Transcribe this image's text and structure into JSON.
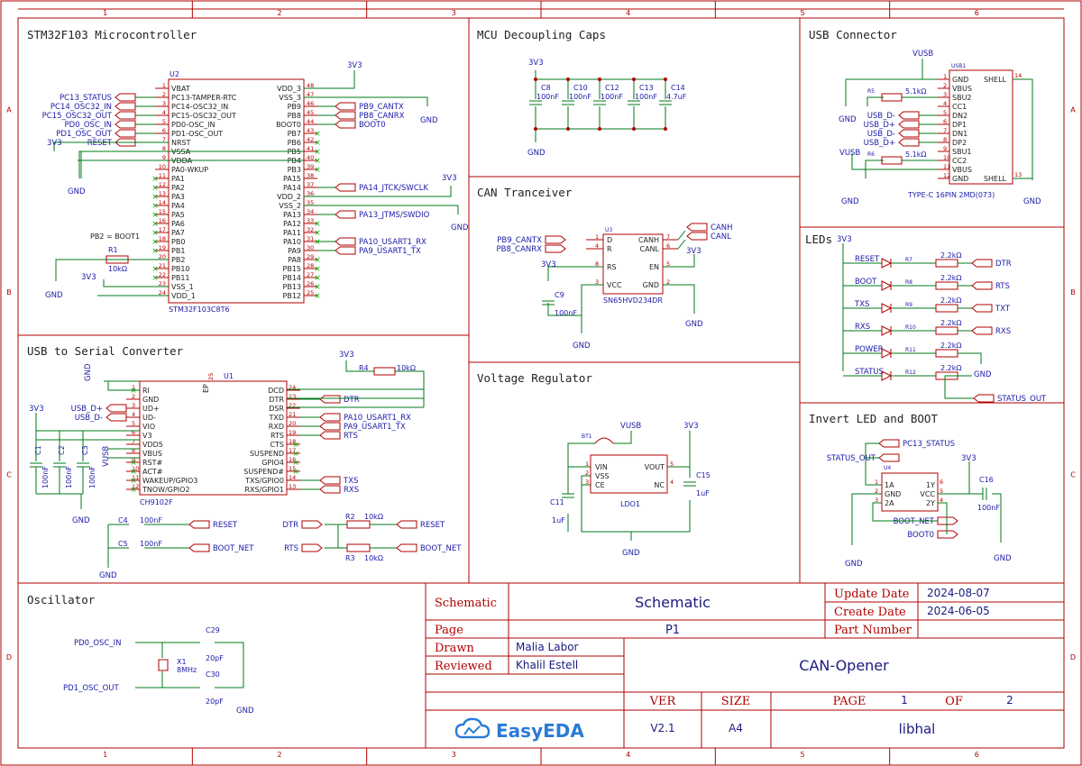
{
  "ruler": {
    "cols": [
      "1",
      "2",
      "3",
      "4",
      "5",
      "6"
    ],
    "rows": [
      "A",
      "B",
      "C",
      "D"
    ]
  },
  "sections": {
    "mcu": "STM32F103 Microcontroller",
    "decoupling": "MCU Decoupling Caps",
    "usb": "USB Connector",
    "can": "CAN Tranceiver",
    "leds": "LEDs",
    "usbserial": "USB to Serial Converter",
    "regulator": "Voltage Regulator",
    "invert": "Invert LED and BOOT",
    "osc": "Oscillator"
  },
  "mcu": {
    "ref": "U2",
    "part": "STM32F103C8T6",
    "left_pins": [
      {
        "n": "1",
        "name": "VBAT"
      },
      {
        "n": "2",
        "name": "PC13-TAMPER-RTC"
      },
      {
        "n": "3",
        "name": "PC14-OSC32_IN"
      },
      {
        "n": "4",
        "name": "PC15-OSC32_OUT"
      },
      {
        "n": "5",
        "name": "PD0-OSC_IN"
      },
      {
        "n": "6",
        "name": "PD1-OSC_OUT"
      },
      {
        "n": "7",
        "name": "NRST"
      },
      {
        "n": "8",
        "name": "VSSA"
      },
      {
        "n": "9",
        "name": "VDDA"
      },
      {
        "n": "10",
        "name": "PA0-WKUP"
      },
      {
        "n": "11",
        "name": "PA1"
      },
      {
        "n": "12",
        "name": "PA2"
      },
      {
        "n": "13",
        "name": "PA3"
      },
      {
        "n": "14",
        "name": "PA4"
      },
      {
        "n": "15",
        "name": "PA5"
      },
      {
        "n": "16",
        "name": "PA6"
      },
      {
        "n": "17",
        "name": "PA7"
      },
      {
        "n": "18",
        "name": "PB0"
      },
      {
        "n": "19",
        "name": "PB1"
      },
      {
        "n": "20",
        "name": "PB2"
      },
      {
        "n": "21",
        "name": "PB10"
      },
      {
        "n": "22",
        "name": "PB11"
      },
      {
        "n": "23",
        "name": "VSS_1"
      },
      {
        "n": "24",
        "name": "VDD_1"
      }
    ],
    "right_pins": [
      {
        "n": "48",
        "name": "VDD_3"
      },
      {
        "n": "47",
        "name": "VSS_3"
      },
      {
        "n": "46",
        "name": "PB9"
      },
      {
        "n": "45",
        "name": "PB8"
      },
      {
        "n": "44",
        "name": "BOOT0"
      },
      {
        "n": "43",
        "name": "PB7"
      },
      {
        "n": "42",
        "name": "PB6"
      },
      {
        "n": "41",
        "name": "PB5"
      },
      {
        "n": "40",
        "name": "PB4"
      },
      {
        "n": "39",
        "name": "PB3"
      },
      {
        "n": "38",
        "name": "PA15"
      },
      {
        "n": "37",
        "name": "PA14"
      },
      {
        "n": "36",
        "name": "VDD_2"
      },
      {
        "n": "35",
        "name": "VSS_2"
      },
      {
        "n": "34",
        "name": "PA13"
      },
      {
        "n": "33",
        "name": "PA12"
      },
      {
        "n": "32",
        "name": "PA11"
      },
      {
        "n": "31",
        "name": "PA10"
      },
      {
        "n": "30",
        "name": "PA9"
      },
      {
        "n": "29",
        "name": "PA8"
      },
      {
        "n": "28",
        "name": "PB15"
      },
      {
        "n": "27",
        "name": "PB14"
      },
      {
        "n": "26",
        "name": "PB13"
      },
      {
        "n": "25",
        "name": "PB12"
      }
    ],
    "left_nets": [
      "PC13_STATUS",
      "PC14_OSC32_IN",
      "PC15_OSC32_OUT",
      "PD0_OSC_IN",
      "PD1_OSC_OUT",
      "RESET"
    ],
    "right_nets": [
      "PB9_CANTX",
      "PB8_CANRX",
      "BOOT0",
      "PA14_JTCK/SWCLK",
      "PA13_JTMS/SWDIO",
      "PA10_USART1_RX",
      "PA9_USART1_TX"
    ],
    "pb2_note": "PB2 = BOOT1",
    "r1_ref": "R1",
    "r1_val": "10kΩ"
  },
  "decoupling": {
    "caps": [
      {
        "ref": "C8",
        "val": "100nF"
      },
      {
        "ref": "C10",
        "val": "100nF"
      },
      {
        "ref": "C12",
        "val": "100nF"
      },
      {
        "ref": "C13",
        "val": "100nF"
      },
      {
        "ref": "C14",
        "val": "4.7uF"
      }
    ]
  },
  "usb": {
    "ref": "USB1",
    "part": "TYPE-C 16PIN 2MD(073)",
    "left_pins": [
      "GND",
      "VBUS",
      "SBU2",
      "CC1",
      "DN2",
      "DP1",
      "DN1",
      "DP2",
      "SBU1",
      "CC2",
      "VBUS",
      "GND"
    ],
    "right_pins": [
      "SHELL",
      "SHELL"
    ],
    "right_nums": [
      "14",
      "13"
    ],
    "nets": [
      "USB_D-",
      "USB_D+",
      "USB_D-",
      "USB_D+"
    ],
    "r5": {
      "ref": "R5",
      "val": "5.1kΩ"
    },
    "r6": {
      "ref": "R6",
      "val": "5.1kΩ"
    }
  },
  "can": {
    "ref": "U3",
    "part": "SN65HVD234DR",
    "left_pins": [
      {
        "n": "1",
        "name": "D"
      },
      {
        "n": "4",
        "name": "R"
      },
      {
        "n": "8",
        "name": "RS"
      },
      {
        "n": "3",
        "name": "VCC"
      }
    ],
    "right_pins": [
      {
        "n": "7",
        "name": "CANH"
      },
      {
        "n": "6",
        "name": "CANL"
      },
      {
        "n": "5",
        "name": "EN"
      },
      {
        "n": "2",
        "name": "GND"
      }
    ],
    "in_nets": [
      "PB9_CANTX",
      "PB8_CANRX"
    ],
    "out_nets": [
      "CANH",
      "CANL"
    ],
    "c9": {
      "ref": "C9",
      "val": "100nF"
    }
  },
  "leds": {
    "items": [
      {
        "net": "RESET",
        "r": "R7",
        "val": "2.2kΩ",
        "out": "DTR"
      },
      {
        "net": "BOOT",
        "r": "R8",
        "val": "2.2kΩ",
        "out": "RTS"
      },
      {
        "net": "TXS",
        "r": "R9",
        "val": "2.2kΩ",
        "out": "TXT"
      },
      {
        "net": "RXS",
        "r": "R10",
        "val": "2.2kΩ",
        "out": "RXS"
      },
      {
        "net": "POWER",
        "r": "R11",
        "val": "2.2kΩ",
        "out": ""
      },
      {
        "net": "STATUS",
        "r": "R12",
        "val": "2.2kΩ",
        "out": "STATUS_OUT"
      }
    ]
  },
  "usbserial": {
    "ref": "U1",
    "part": "CH9102F",
    "left_pins": [
      {
        "n": "1",
        "name": "RI"
      },
      {
        "n": "2",
        "name": "GND"
      },
      {
        "n": "3",
        "name": "UD+"
      },
      {
        "n": "4",
        "name": "UD-"
      },
      {
        "n": "5",
        "name": "VIO"
      },
      {
        "n": "6",
        "name": "V3"
      },
      {
        "n": "7",
        "name": "VDD5"
      },
      {
        "n": "8",
        "name": "VBUS"
      },
      {
        "n": "9",
        "name": "RST#"
      },
      {
        "n": "10",
        "name": "ACT#"
      },
      {
        "n": "11",
        "name": "WAKEUP/GPIO3"
      },
      {
        "n": "12",
        "name": "TNOW/GPIO2"
      }
    ],
    "right_pins": [
      {
        "n": "24",
        "name": "DCD"
      },
      {
        "n": "23",
        "name": "DTR"
      },
      {
        "n": "22",
        "name": "DSR"
      },
      {
        "n": "21",
        "name": "TXD"
      },
      {
        "n": "20",
        "name": "RXD"
      },
      {
        "n": "19",
        "name": "RTS"
      },
      {
        "n": "18",
        "name": "CTS"
      },
      {
        "n": "17",
        "name": "SUSPEND"
      },
      {
        "n": "16",
        "name": "GPIO4"
      },
      {
        "n": "15",
        "name": "SUSPEND#"
      },
      {
        "n": "14",
        "name": "TXS/GPIO0"
      },
      {
        "n": "13",
        "name": "RXS/GPIO1"
      }
    ],
    "ep_pin": "EP",
    "ep_num": "25",
    "in_nets": [
      "USB_D+",
      "USB_D-"
    ],
    "out_nets": [
      "DTR",
      "PA10_USART1_RX",
      "PA9_USART1_TX",
      "RTS",
      "TXS",
      "RXS"
    ],
    "r4": {
      "ref": "R4",
      "val": "10kΩ"
    },
    "caps": [
      {
        "ref": "C1",
        "val": "100nF"
      },
      {
        "ref": "C2",
        "val": "100nF"
      },
      {
        "ref": "C3",
        "val": "100nF"
      }
    ],
    "c4": {
      "ref": "C4",
      "val": "100nF",
      "net": "RESET"
    },
    "c5": {
      "ref": "C5",
      "val": "100nF",
      "net": "BOOT_NET"
    },
    "r2": {
      "ref": "R2",
      "val": "10kΩ",
      "in": "DTR",
      "out": "RESET"
    },
    "r3": {
      "ref": "R3",
      "val": "10kΩ",
      "in": "RTS",
      "out": "BOOT_NET"
    }
  },
  "regulator": {
    "ref": "LDO1",
    "bt": "BT1",
    "left_pins": [
      {
        "n": "1",
        "name": "VIN"
      },
      {
        "n": "2",
        "name": "VSS"
      },
      {
        "n": "3",
        "name": "CE"
      }
    ],
    "right_pins": [
      {
        "n": "5",
        "name": "VOUT"
      },
      {
        "n": "4",
        "name": "NC"
      }
    ],
    "c11": {
      "ref": "C11",
      "val": "1uF"
    },
    "c15": {
      "ref": "C15",
      "val": "1uF"
    }
  },
  "invert": {
    "ref": "U4",
    "left_pins": [
      {
        "n": "1",
        "name": "1A"
      },
      {
        "n": "2",
        "name": "GND"
      },
      {
        "n": "3",
        "name": "2A"
      }
    ],
    "right_pins": [
      {
        "n": "6",
        "name": "1Y"
      },
      {
        "n": "5",
        "name": "VCC"
      },
      {
        "n": "4",
        "name": "2Y"
      }
    ],
    "nets": [
      "PC13_STATUS",
      "STATUS_OUT",
      "BOOT_NET",
      "BOOT0"
    ],
    "c16": {
      "ref": "C16",
      "val": "100nF"
    }
  },
  "osc": {
    "nets": [
      "PD0_OSC_IN",
      "PD1_OSC_OUT"
    ],
    "x1": {
      "ref": "X1",
      "val": "8MHz"
    },
    "c29": {
      "ref": "C29",
      "val": "20pF"
    },
    "c30": {
      "ref": "C30",
      "val": "20pF"
    }
  },
  "power": {
    "v33": "3V3",
    "gnd": "GND",
    "vusb": "VUSB"
  },
  "titleblock": {
    "schematic_label": "Schematic",
    "schematic_value": "Schematic",
    "page_label": "Page",
    "page_value": "P1",
    "drawn_label": "Drawn",
    "drawn_value": "Malia Labor",
    "reviewed_label": "Reviewed",
    "reviewed_value": "Khalil Estell",
    "update_label": "Update Date",
    "update_value": "2024-08-07",
    "create_label": "Create Date",
    "create_value": "2024-06-05",
    "partnum_label": "Part Number",
    "project": "CAN-Opener",
    "ver_label": "VER",
    "ver_value": "V2.1",
    "size_label": "SIZE",
    "size_value": "A4",
    "pg_label": "PAGE",
    "pg_num": "1",
    "of_label": "OF",
    "pg_total": "2",
    "company": "libhal",
    "logo": "EasyEDA"
  },
  "colors": {
    "frame": "#b00000",
    "wire": "#007a1a",
    "label": "#1a1aa8",
    "text": "#222222",
    "logo": "#2b7bd6"
  }
}
